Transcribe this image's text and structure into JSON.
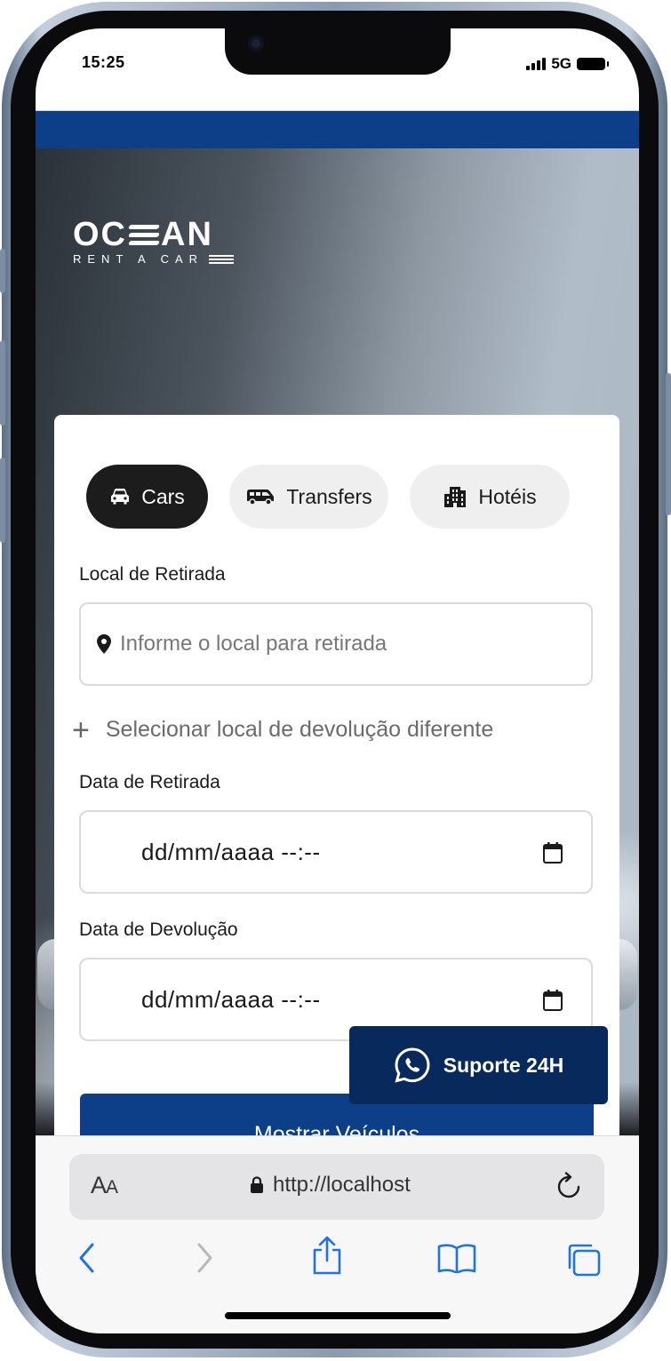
{
  "status_bar": {
    "time": "15:25",
    "network": "5G"
  },
  "brand": {
    "name_left": "OC",
    "name_right": "AN",
    "tagline": "RENT A CAR"
  },
  "tabs": [
    {
      "label": "Cars",
      "icon": "car-icon",
      "active": true
    },
    {
      "label": "Transfers",
      "icon": "van-icon",
      "active": false
    },
    {
      "label": "Hotéis",
      "icon": "building-icon",
      "active": false
    }
  ],
  "pickup": {
    "label": "Local de Retirada",
    "placeholder": "Informe o local para retirada"
  },
  "different_return": {
    "label": "Selecionar local de devolução diferente"
  },
  "pickup_date": {
    "label": "Data de Retirada",
    "value": "dd/mm/aaaa --:--"
  },
  "return_date": {
    "label": "Data de Devolução",
    "value": "dd/mm/aaaa --:--"
  },
  "submit": {
    "label": "Mostrar Veículos"
  },
  "support": {
    "label": "Suporte 24H"
  },
  "browser": {
    "text_size": "AA",
    "url": "http://localhost"
  },
  "colors": {
    "primary": "#0c3f87",
    "support_bg": "#07295c",
    "active_tab": "#1c1c1c",
    "inactive_tab": "#efefef"
  }
}
